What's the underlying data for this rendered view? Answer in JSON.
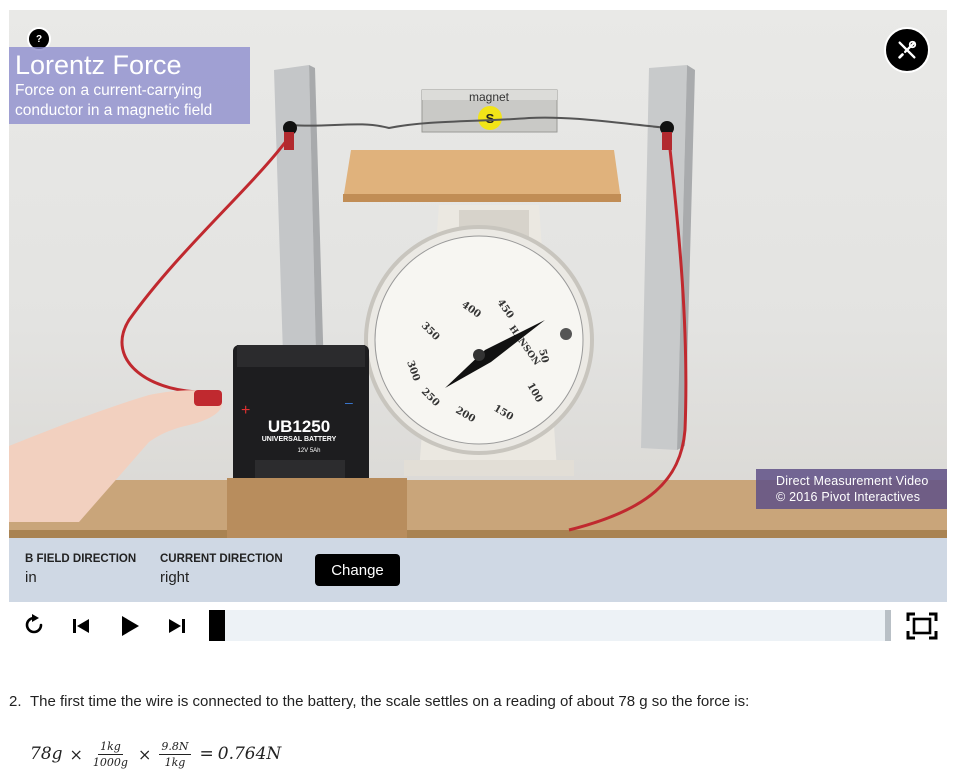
{
  "video": {
    "help_label": "?",
    "title": "Lorentz Force",
    "subtitle_line1": "Force on a current-carrying",
    "subtitle_line2": "conductor in a magnetic field",
    "credit_line1": "Direct Measurement Video",
    "credit_line2": "© 2016 Pivot Interactives",
    "scene": {
      "magnet_label": "magnet",
      "magnet_badge": "S",
      "battery_brand": "UB1250",
      "battery_type": "UNIVERSAL BATTERY",
      "battery_spec": "12V  5Ah",
      "battery_plus": "+",
      "battery_minus": "–",
      "scale_brand": "HANSON",
      "scale_numbers": [
        "400",
        "450",
        "50",
        "100",
        "150",
        "200",
        "250",
        "300",
        "350"
      ]
    }
  },
  "controls": {
    "b_field_label": "B FIELD DIRECTION",
    "b_field_value": "in",
    "current_label": "CURRENT DIRECTION",
    "current_value": "right",
    "change_label": "Change"
  },
  "player": {
    "icons": [
      "replay-icon",
      "skip-to-start-icon",
      "play-icon",
      "step-forward-icon",
      "fullscreen-icon"
    ],
    "progress": 0
  },
  "question": {
    "number": "2.",
    "text": "The first time the wire is connected to the battery, the scale settles on a reading of about 78 g so the force is:"
  },
  "equation": {
    "mass": "78g",
    "times": "×",
    "frac1_num": "1kg",
    "frac1_den": "1000g",
    "frac2_num": "9.8N",
    "frac2_den": "1kg",
    "equals": "=",
    "result": "0.764N"
  }
}
